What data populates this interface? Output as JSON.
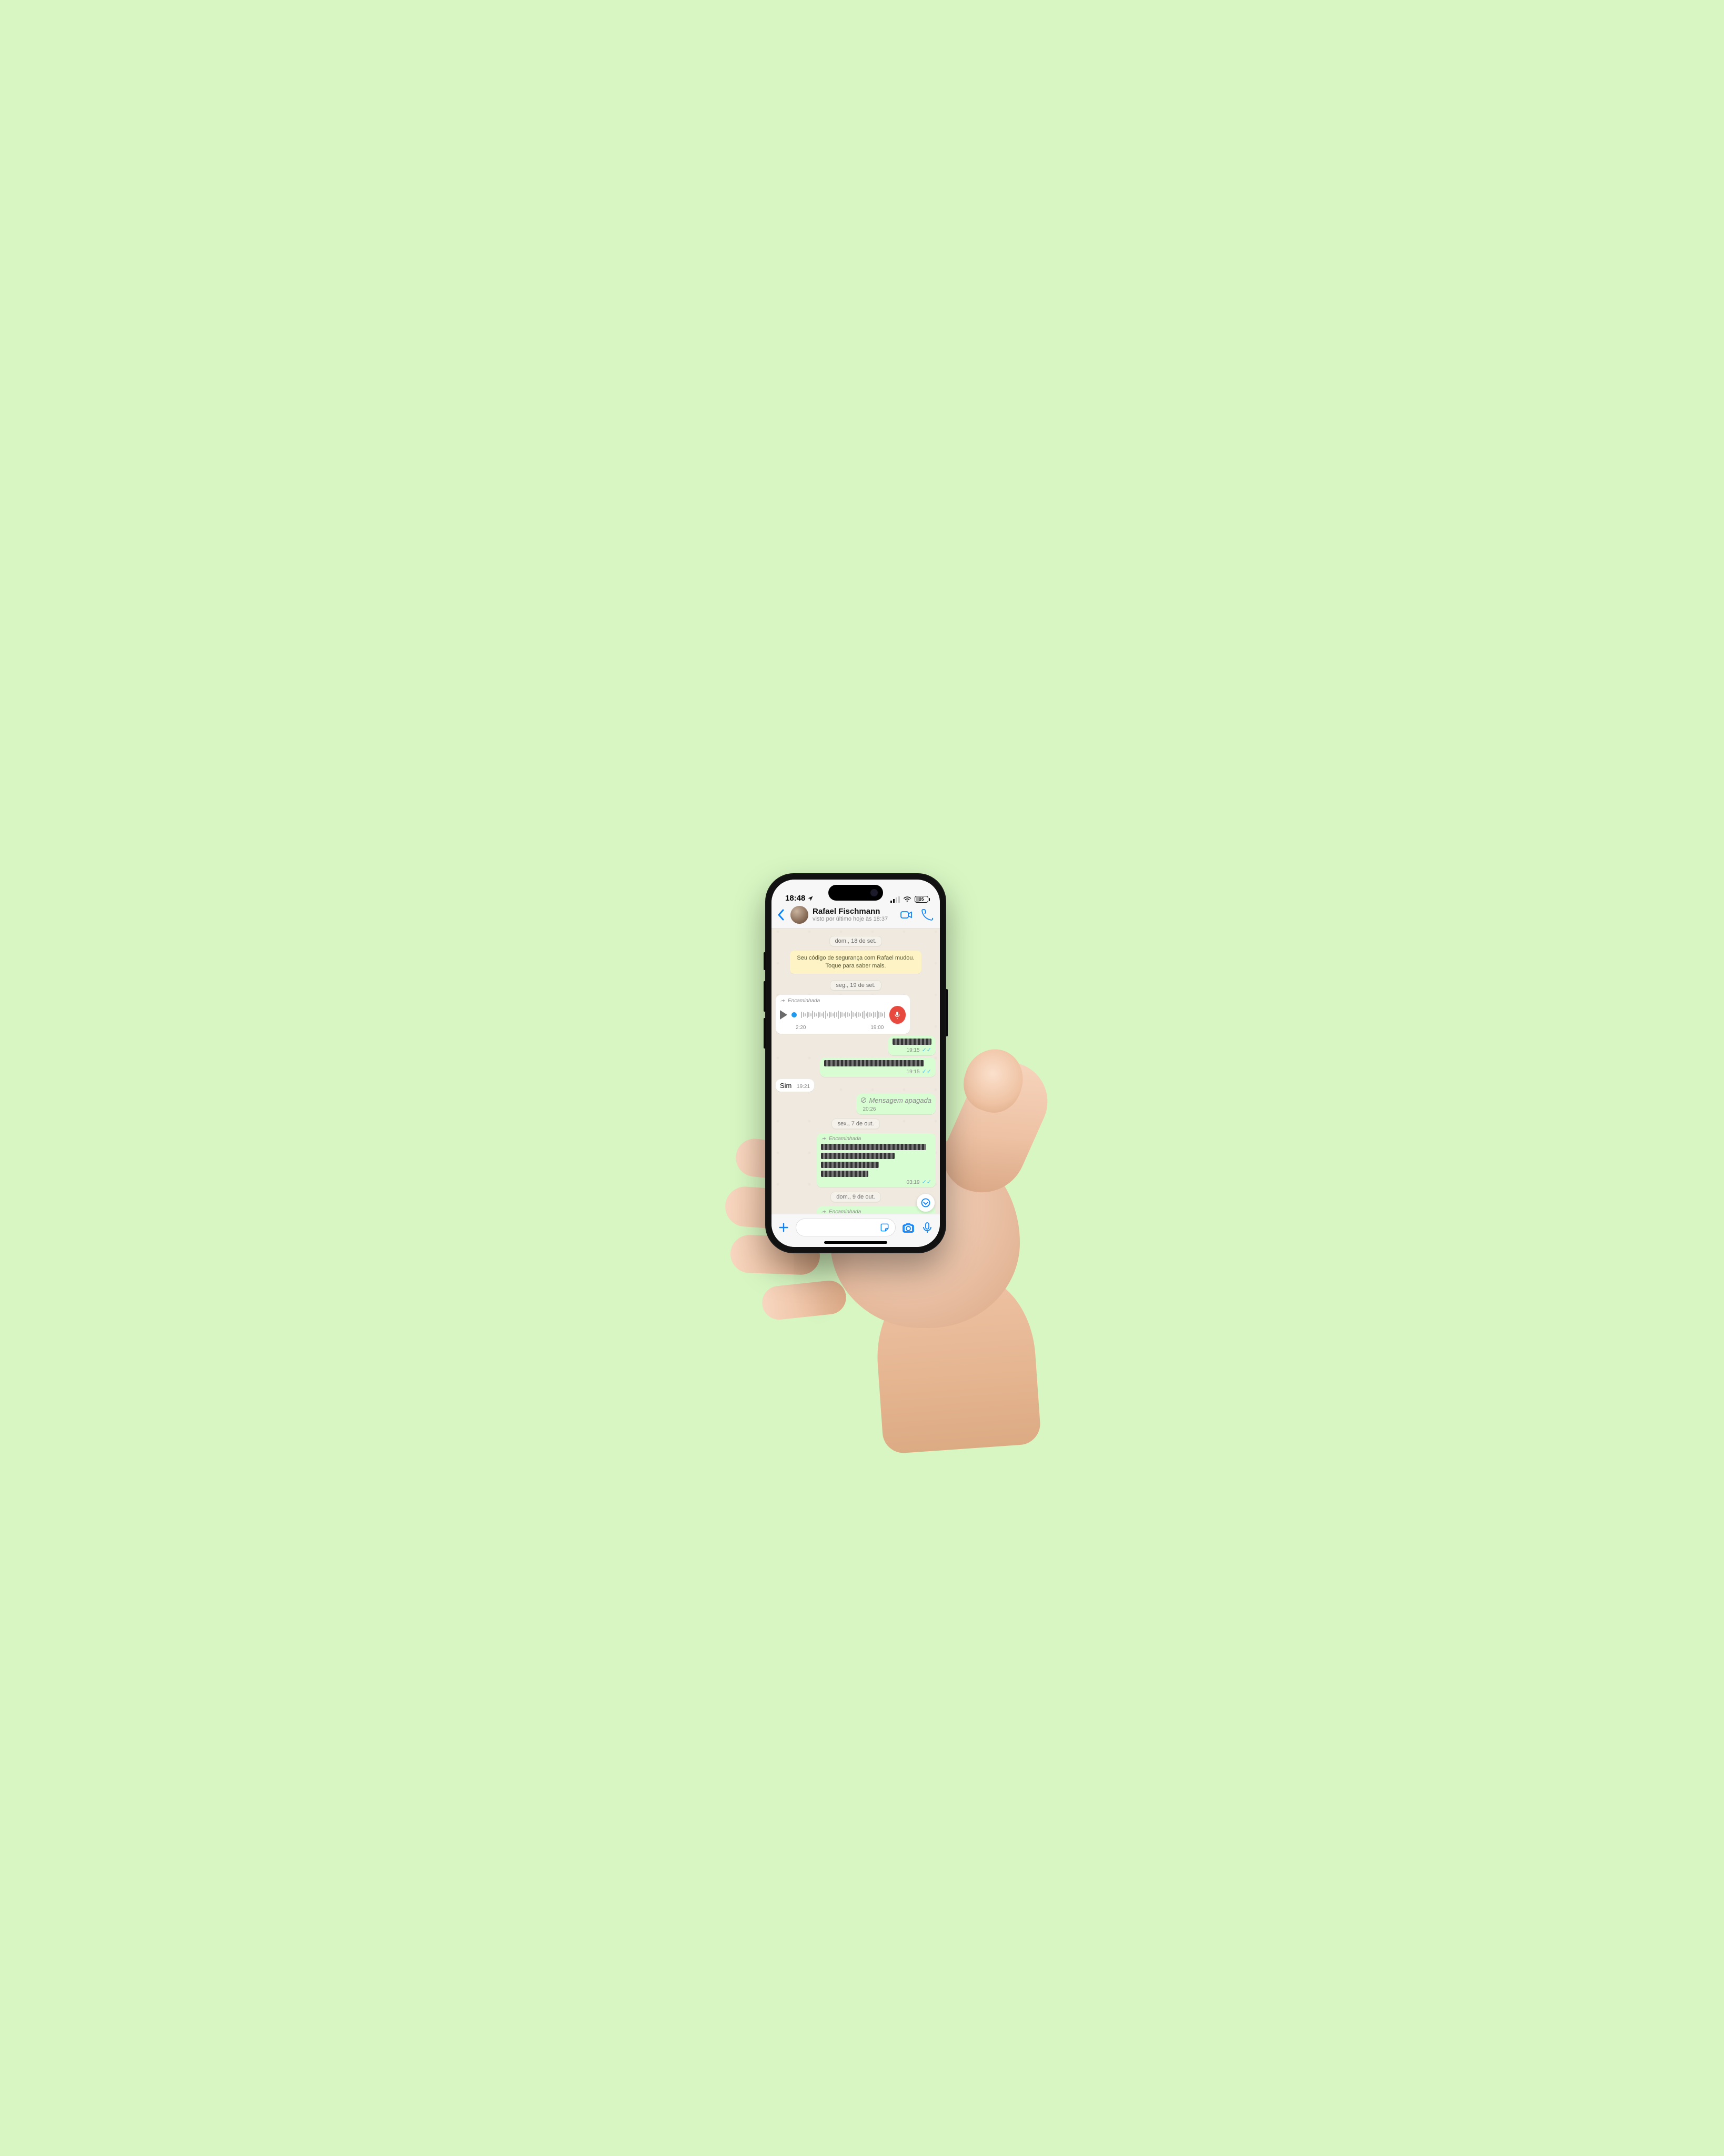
{
  "status": {
    "time": "18:48",
    "battery_pct": "35"
  },
  "header": {
    "contact_name": "Rafael Fischmann",
    "last_seen_prefix": "visto por último hoje às ",
    "last_seen_time": "18:37"
  },
  "dates": {
    "d1": "dom., 18 de set.",
    "d2": "seg., 19 de set.",
    "d3": "sex., 7 de out.",
    "d4": "dom., 9 de out."
  },
  "security": {
    "line1": "Seu código de segurança com Rafael mudou.",
    "line2": "Toque para saber mais."
  },
  "labels": {
    "forwarded": "Encaminhada",
    "deleted": "Mensagem apagada"
  },
  "voice": {
    "elapsed": "2:20",
    "time": "19:00"
  },
  "messages": {
    "out1_time": "19:15",
    "out2_time": "19:15",
    "in_sim_text": "Sim",
    "in_sim_time": "19:21",
    "deleted_time": "20:26",
    "out_fwd_time": "03:19"
  },
  "colors": {
    "accent": "#0a84ff",
    "outgoing": "#d8fdd2",
    "incoming": "#ffffff",
    "security_bg": "#fdf3c4",
    "mic_red": "#e8493f"
  }
}
